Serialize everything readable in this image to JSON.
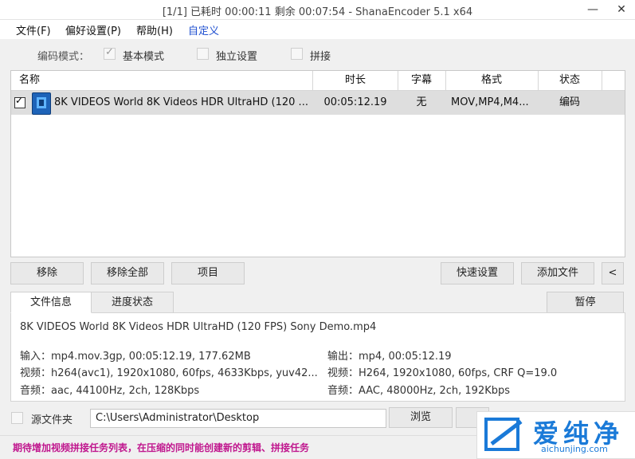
{
  "window": {
    "title": "[1/1] 已耗时 00:00:11   剩余 00:07:54 - ShanaEncoder 5.1 x64",
    "minimize": "—",
    "close": "✕"
  },
  "menu": [
    "文件(F)",
    "偏好设置(P)",
    "帮助(H)",
    "自定义"
  ],
  "mode": {
    "label": "编码模式：",
    "basic": "基本模式",
    "independent": "独立设置",
    "concat": "拼接"
  },
  "table": {
    "headers": [
      "名称",
      "时长",
      "字幕",
      "格式",
      "状态"
    ],
    "rows": [
      {
        "checked": true,
        "name": "8K VIDEOS    World 8K Videos HDR UltraHD  (120 ...",
        "duration": "00:05:12.19",
        "subtitle": "无",
        "format": "MOV,MP4,M4...",
        "status": "编码"
      }
    ]
  },
  "buttons": {
    "remove": "移除",
    "remove_all": "移除全部",
    "item": "项目",
    "quick_settings": "快速设置",
    "add_file": "添加文件",
    "collapse": "<",
    "pause": "暂停",
    "browse": "浏览"
  },
  "tabs": [
    "文件信息",
    "进度状态"
  ],
  "info": {
    "filename": "8K VIDEOS    World 8K Videos HDR UltraHD  (120 FPS)   Sony Demo.mp4",
    "input": "输入：mp4.mov.3gp, 00:05:12.19, 177.62MB",
    "video_in": "视频：h264(avc1), 1920x1080, 60fps, 4633Kbps,  yuv42...",
    "audio_in": "音频：aac, 44100Hz, 2ch, 128Kbps",
    "output": "输出：mp4, 00:05:12.19",
    "video_out": "视频：H264, 1920x1080, 60fps, CRF Q=19.0",
    "audio_out": "音频：AAC, 48000Hz, 2ch, 192Kbps"
  },
  "source": {
    "label": "源文件夹",
    "path": "C:\\Users\\Administrator\\Desktop"
  },
  "status_message": "期待增加视频拼接任务列表，在压缩的同时能创建新的剪辑、拼接任务",
  "watermark": {
    "text": "爱纯净",
    "url": "aichunjing.com"
  },
  "colors": {
    "accent_menu": "#2050d0",
    "status_text": "#c0178e",
    "watermark": "#1a7ad8",
    "selected_row": "#dedede"
  }
}
